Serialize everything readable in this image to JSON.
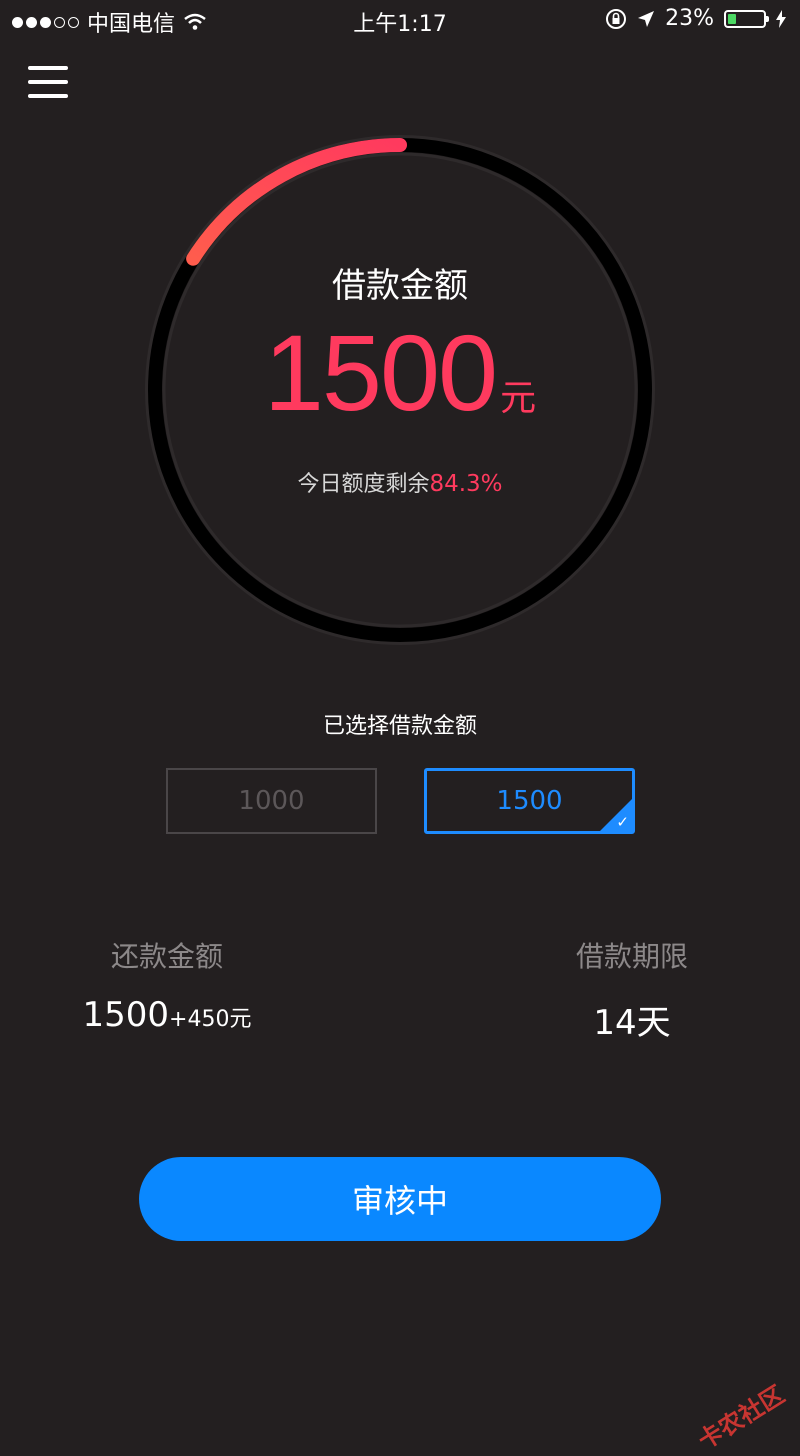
{
  "status_bar": {
    "carrier": "中国电信",
    "time": "上午1:17",
    "battery_percent": "23%",
    "signal_bars_filled": 3,
    "signal_bars_total": 5
  },
  "header": {
    "menu_icon": "hamburger-menu-icon"
  },
  "gauge": {
    "title": "借款金额",
    "amount": "1500",
    "unit": "元",
    "remaining_label": "今日额度剩余",
    "remaining_percent": "84.3%",
    "arc_fraction": 0.16,
    "accent_color": "#ff3a5e"
  },
  "selection": {
    "label": "已选择借款金额",
    "options": [
      {
        "value": "1000",
        "selected": false
      },
      {
        "value": "1500",
        "selected": true
      }
    ]
  },
  "repayment": {
    "label": "还款金额",
    "amount": "1500",
    "extra": "+450元"
  },
  "term": {
    "label": "借款期限",
    "value": "14天"
  },
  "action": {
    "label": "审核中",
    "color": "#0a88ff"
  },
  "watermark": "卡农社区"
}
